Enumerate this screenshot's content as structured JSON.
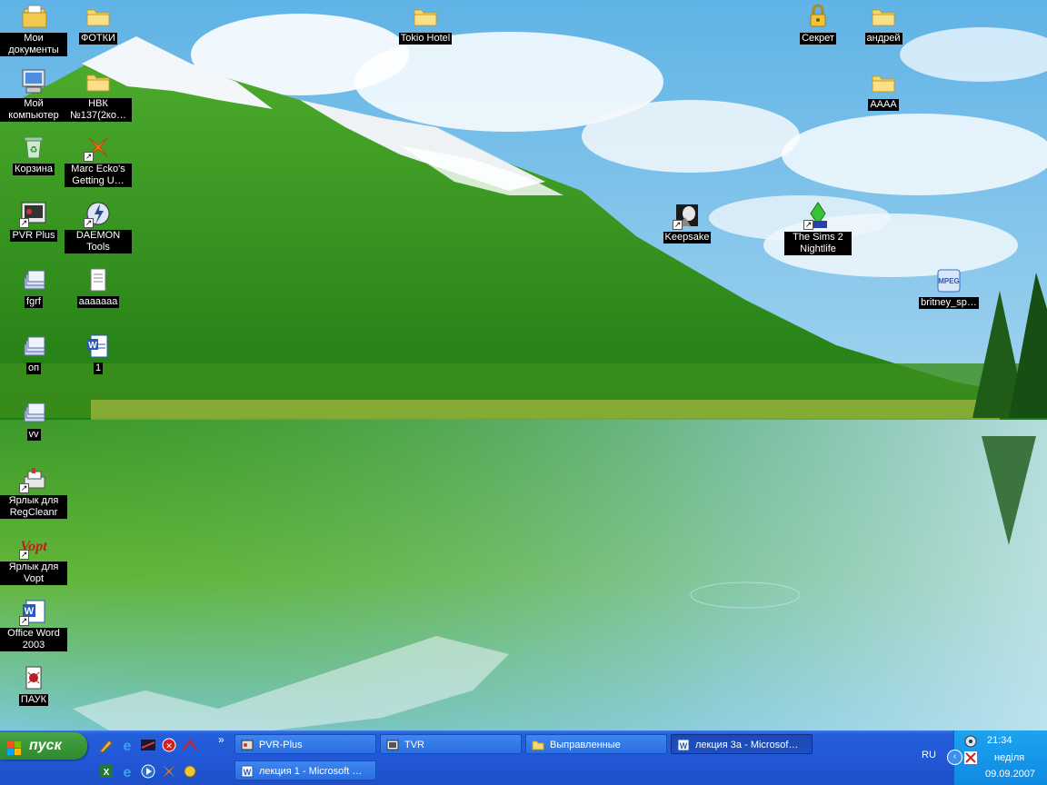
{
  "desktop": {
    "icons": [
      {
        "label": "Мои документы"
      },
      {
        "label": "ФОТКИ"
      },
      {
        "label": "Tokio Hotel"
      },
      {
        "label": "Секрет"
      },
      {
        "label": "андрей"
      },
      {
        "label": "Мой компьютер"
      },
      {
        "label": "НВК №137(2ко…"
      },
      {
        "label": "АААА"
      },
      {
        "label": "Корзина"
      },
      {
        "label": "Marc Ecko's Getting U…"
      },
      {
        "label": "PVR Plus"
      },
      {
        "label": "DAEMON Tools"
      },
      {
        "label": "Keepsake"
      },
      {
        "label": "The Sims 2 Nightlife"
      },
      {
        "label": "fgrf"
      },
      {
        "label": "ааааааа"
      },
      {
        "label": "britney_sp…"
      },
      {
        "label": "оп"
      },
      {
        "label": "1"
      },
      {
        "label": "vv"
      },
      {
        "label": "Ярлык для RegCleanr"
      },
      {
        "label": "Ярлык для Vopt"
      },
      {
        "label": "Office Word 2003"
      },
      {
        "label": "ПАУК"
      }
    ]
  },
  "taskbar": {
    "start_label": "пуск",
    "tasks": [
      {
        "label": "PVR-Plus"
      },
      {
        "label": "TVR"
      },
      {
        "label": "Выправленные"
      },
      {
        "label": "лекция 3а - Microsof…"
      },
      {
        "label": "лекция 1 - Microsoft …"
      }
    ],
    "overflow_chevron": "»",
    "language": "RU"
  },
  "tray": {
    "time": "21:34",
    "day": "неділя",
    "date": "09.09.2007",
    "collapse_glyph": "‹"
  },
  "colors": {
    "taskbar": "#245edb",
    "start": "#3a9a38",
    "tray": "#0f8ae2",
    "active_task": "#1e4fbf"
  }
}
